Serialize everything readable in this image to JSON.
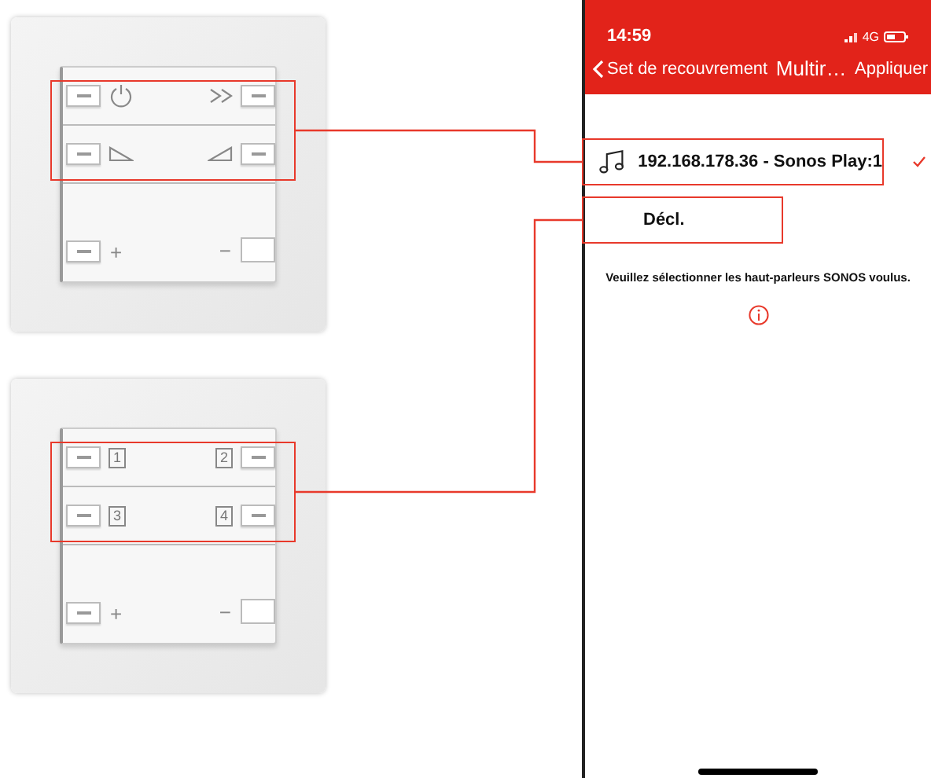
{
  "switches": [
    {
      "rows": [
        {
          "left": {
            "kind": "power"
          },
          "right": {
            "kind": "skip"
          }
        },
        {
          "left": {
            "kind": "ramp-down"
          },
          "right": {
            "kind": "ramp-up"
          }
        }
      ],
      "plus": "+",
      "minus": "−"
    },
    {
      "rows": [
        {
          "left": {
            "kind": "number",
            "label": "1"
          },
          "right": {
            "kind": "number",
            "label": "2"
          }
        },
        {
          "left": {
            "kind": "number",
            "label": "3"
          },
          "right": {
            "kind": "number",
            "label": "4"
          }
        }
      ],
      "plus": "+",
      "minus": "−"
    }
  ],
  "phone": {
    "time": "14:59",
    "network": "4G",
    "back": "Set de recouvrement",
    "title": "Multir…",
    "action": "Appliquer",
    "speakers": [
      {
        "label": "192.168.178.36 - Sonos Play:1",
        "checked": true
      }
    ],
    "off_option": "Décl.",
    "message": "Veuillez sélectionner les haut-parleurs SONOS voulus."
  }
}
